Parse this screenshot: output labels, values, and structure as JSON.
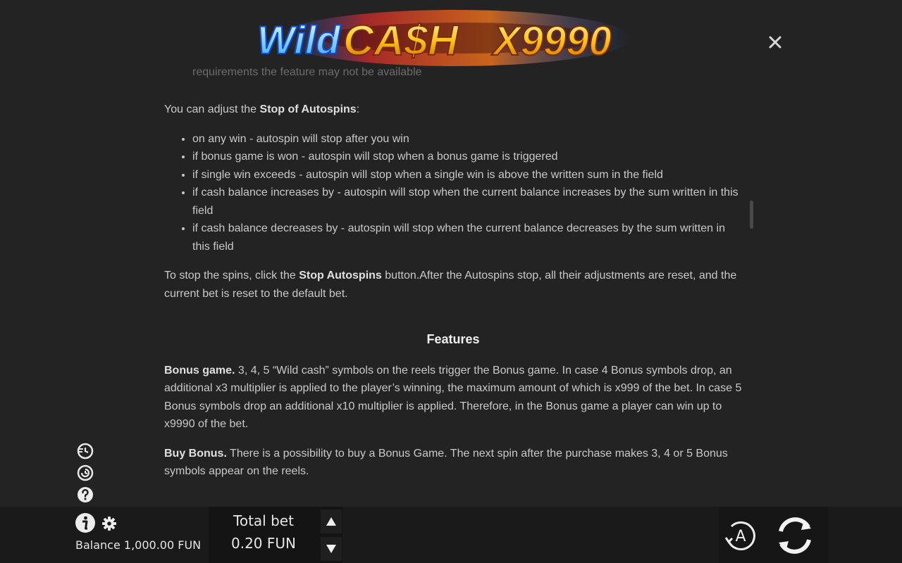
{
  "logo": {
    "word1": "Wild",
    "word2": "CA$H",
    "word3": "X9990"
  },
  "rules": {
    "faded_line": "requirements the feature may not be available",
    "stop_intro_prefix": "You can adjust the ",
    "stop_intro_bold": "Stop of Autospins",
    "stop_intro_suffix": ":",
    "stop_items": [
      "on any win - autospin will stop after you win",
      "if bonus game is won - autospin will stop when a bonus game is triggered",
      "if single win exceeds - autospin will stop when a single win is above the written sum in the field",
      "if cash balance increases by - autospin will stop when the current balance increases by the sum written in this field",
      "if cash balance decreases by - autospin will stop when the current balance decreases by the sum written in this field"
    ],
    "stop_spins_prefix": "To stop the spins, click the ",
    "stop_spins_bold": "Stop Autospins",
    "stop_spins_suffix": " button.After the Autospins stop, all their adjustments are reset, and the current bet is reset to the default bet.",
    "features_heading": "Features",
    "bonus_bold": "Bonus game.",
    "bonus_text": " 3, 4, 5 “Wild cash” symbols on the reels trigger the Bonus game. In case 4 Bonus symbols drop, an additional x3 multiplier is applied to the player’s winning, the maximum amount of which is x999 of the bet. In case 5 Bonus symbols drop an additional x10 multiplier is applied. Therefore, in the Bonus game a player can win up to x9990 of the bet.",
    "buy_bold": "Buy Bonus.",
    "buy_text": " There is a possibility to buy a Bonus Game. The next spin after the purchase makes 3, 4 or 5 Bonus symbols appear on the reels."
  },
  "bottom": {
    "total_bet_label": "Total bet",
    "total_bet_value": "0.20 FUN",
    "balance": "Balance 1,000.00 FUN",
    "auto_label": "A"
  },
  "icons": {
    "close": "close-icon",
    "side": [
      "turbo-icon",
      "history-icon",
      "help-icon"
    ],
    "info": "info-icon",
    "settings": "gear-icon",
    "bet_up": "triangle-up-icon",
    "bet_down": "triangle-down-icon",
    "autoplay": "autoplay-icon",
    "spin": "spin-icon"
  },
  "colors": {
    "background": "#232323",
    "bar": "#1a1a1a",
    "text": "#c9c9c9"
  }
}
